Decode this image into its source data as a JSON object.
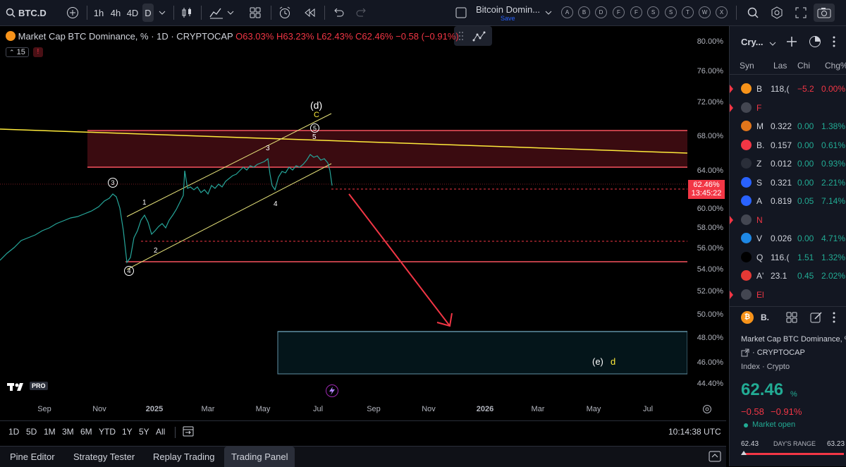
{
  "toolbar": {
    "symbol": "BTC.D",
    "intervals": [
      "1h",
      "4h",
      "4D",
      "D"
    ],
    "active_interval": "D",
    "layout_name": "Bitcoin Domin...",
    "save_label": "Save",
    "letters": [
      "A",
      "B",
      "D",
      "F",
      "F",
      "S",
      "S",
      "T",
      "W",
      "X"
    ]
  },
  "legend": {
    "title": "Market Cap BTC Dominance, % · 1D · CRYPTOCAP",
    "open": "O63.03%",
    "high": "H63.23%",
    "low": "L62.43%",
    "close": "C62.46%",
    "change": "−0.58 (−0.91%)",
    "indicator_count": "15"
  },
  "price_axis": {
    "labels": [
      "80.00%",
      "76.00%",
      "72.00%",
      "68.00%",
      "64.00%",
      "60.00%",
      "58.00%",
      "56.00%",
      "54.00%",
      "52.00%",
      "50.00%",
      "48.00%",
      "46.00%",
      "44.40%"
    ],
    "current_price": "62.46%",
    "countdown": "13:45:22"
  },
  "time_axis": {
    "labels": [
      "Sep",
      "Nov",
      "2025",
      "Mar",
      "May",
      "Jul",
      "Sep",
      "Nov",
      "2026",
      "Mar",
      "May",
      "Jul"
    ]
  },
  "annotations": {
    "wave_d": "(d)",
    "wave_c": "C",
    "wave_e": "(e)",
    "wave_e_d": "d",
    "w1": "1",
    "w2": "2",
    "w3": "3",
    "w4": "4",
    "w5": "5",
    "c3": "3",
    "c4": "4",
    "c5": "5",
    "logo": "PRO"
  },
  "range": {
    "buttons": [
      "1D",
      "5D",
      "1M",
      "3M",
      "6M",
      "YTD",
      "1Y",
      "5Y",
      "All"
    ],
    "clock": "10:14:38 UTC"
  },
  "bottom_tabs": [
    "Pine Editor",
    "Strategy Tester",
    "Replay Trading",
    "Trading Panel"
  ],
  "watchlist": {
    "title": "Cry...",
    "headers": [
      "Syn",
      "Las",
      "Chi",
      "Chg%"
    ],
    "rows": [
      {
        "sym": "B",
        "last": "118,(",
        "chg": "−5.2",
        "pct": "0.00%",
        "color": "#f7931a",
        "dir": "red"
      },
      {
        "sym": "F",
        "last": "",
        "chg": "",
        "pct": "",
        "color": "#434651",
        "dir": "red"
      },
      {
        "sym": "M",
        "last": "0.322",
        "chg": "0.00",
        "pct": "1.38%",
        "color": "#e2761b",
        "dir": "green"
      },
      {
        "sym": "B.",
        "last": "0.157",
        "chg": "0.00",
        "pct": "0.61%",
        "color": "#f23645",
        "dir": "green"
      },
      {
        "sym": "Z",
        "last": "0.012",
        "chg": "0.00",
        "pct": "0.93%",
        "color": "#2a2e39",
        "dir": "green"
      },
      {
        "sym": "S",
        "last": "0.321",
        "chg": "0.00",
        "pct": "2.21%",
        "color": "#2962ff",
        "dir": "green"
      },
      {
        "sym": "A",
        "last": "0.819",
        "chg": "0.05",
        "pct": "7.14%",
        "color": "#2962ff",
        "dir": "green"
      },
      {
        "sym": "N",
        "last": "",
        "chg": "",
        "pct": "",
        "color": "#434651",
        "dir": "red"
      },
      {
        "sym": "V",
        "last": "0.026",
        "chg": "0.00",
        "pct": "4.71%",
        "color": "#1e88e5",
        "dir": "green"
      },
      {
        "sym": "Q",
        "last": "116.(",
        "chg": "1.51",
        "pct": "1.32%",
        "color": "#000000",
        "dir": "green"
      },
      {
        "sym": "A'",
        "last": "23.1",
        "chg": "0.45",
        "pct": "2.02%",
        "color": "#e53935",
        "dir": "green"
      },
      {
        "sym": "El",
        "last": "",
        "chg": "",
        "pct": "",
        "color": "#434651",
        "dir": "red"
      }
    ]
  },
  "details": {
    "symbol_short": "B.",
    "name": "Market Cap BTC Dominance, %",
    "exchange": "CRYPTOCAP",
    "category": "Index · Crypto",
    "price": "62.46",
    "unit": "%",
    "change": "−0.58",
    "change_pct": "−0.91%",
    "status": "Market open",
    "range_low": "62.43",
    "range_label": "DAY'S RANGE",
    "range_high": "63.23"
  },
  "colors": {
    "up": "#22ab94",
    "down": "#f23645",
    "accent": "#2962ff",
    "zone": "#f7525f",
    "trendline": "#ffeb3b"
  }
}
